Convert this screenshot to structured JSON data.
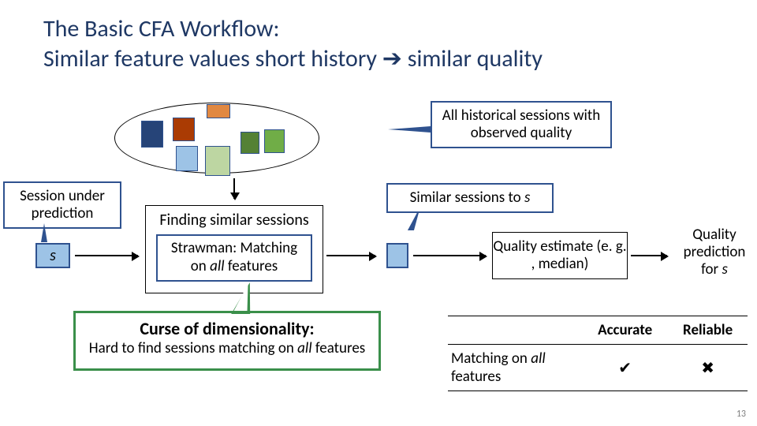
{
  "title_line1": "The Basic CFA Workflow:",
  "title_line2_a": "Similar feature values short history ",
  "title_line2_b": " similar quality",
  "arrow": "➔",
  "callout_history": "All historical sessions with observed quality",
  "callout_session_under": "Session under prediction",
  "callout_similar_a": "Similar sessions to ",
  "callout_similar_s": "s",
  "s": "s",
  "finding_label": "Finding similar sessions",
  "strawman_a": "Strawman: Matching",
  "strawman_b1": "on ",
  "strawman_b2": "all",
  "strawman_b3": " features",
  "estimate": "Quality estimate (e. g. , median)",
  "prediction_a": "Quality prediction for ",
  "prediction_s": "s",
  "curse_title": "Curse of dimensionality:",
  "curse_body_a": "Hard to find sessions matching on ",
  "curse_body_b": "all",
  "curse_body_c": " features",
  "tbl": {
    "h1": "Accurate",
    "h2": "Reliable",
    "row1_a": "Matching on ",
    "row1_i": "all",
    "row1_b": " features",
    "check": "✔",
    "cross": "✖"
  },
  "page": "13"
}
